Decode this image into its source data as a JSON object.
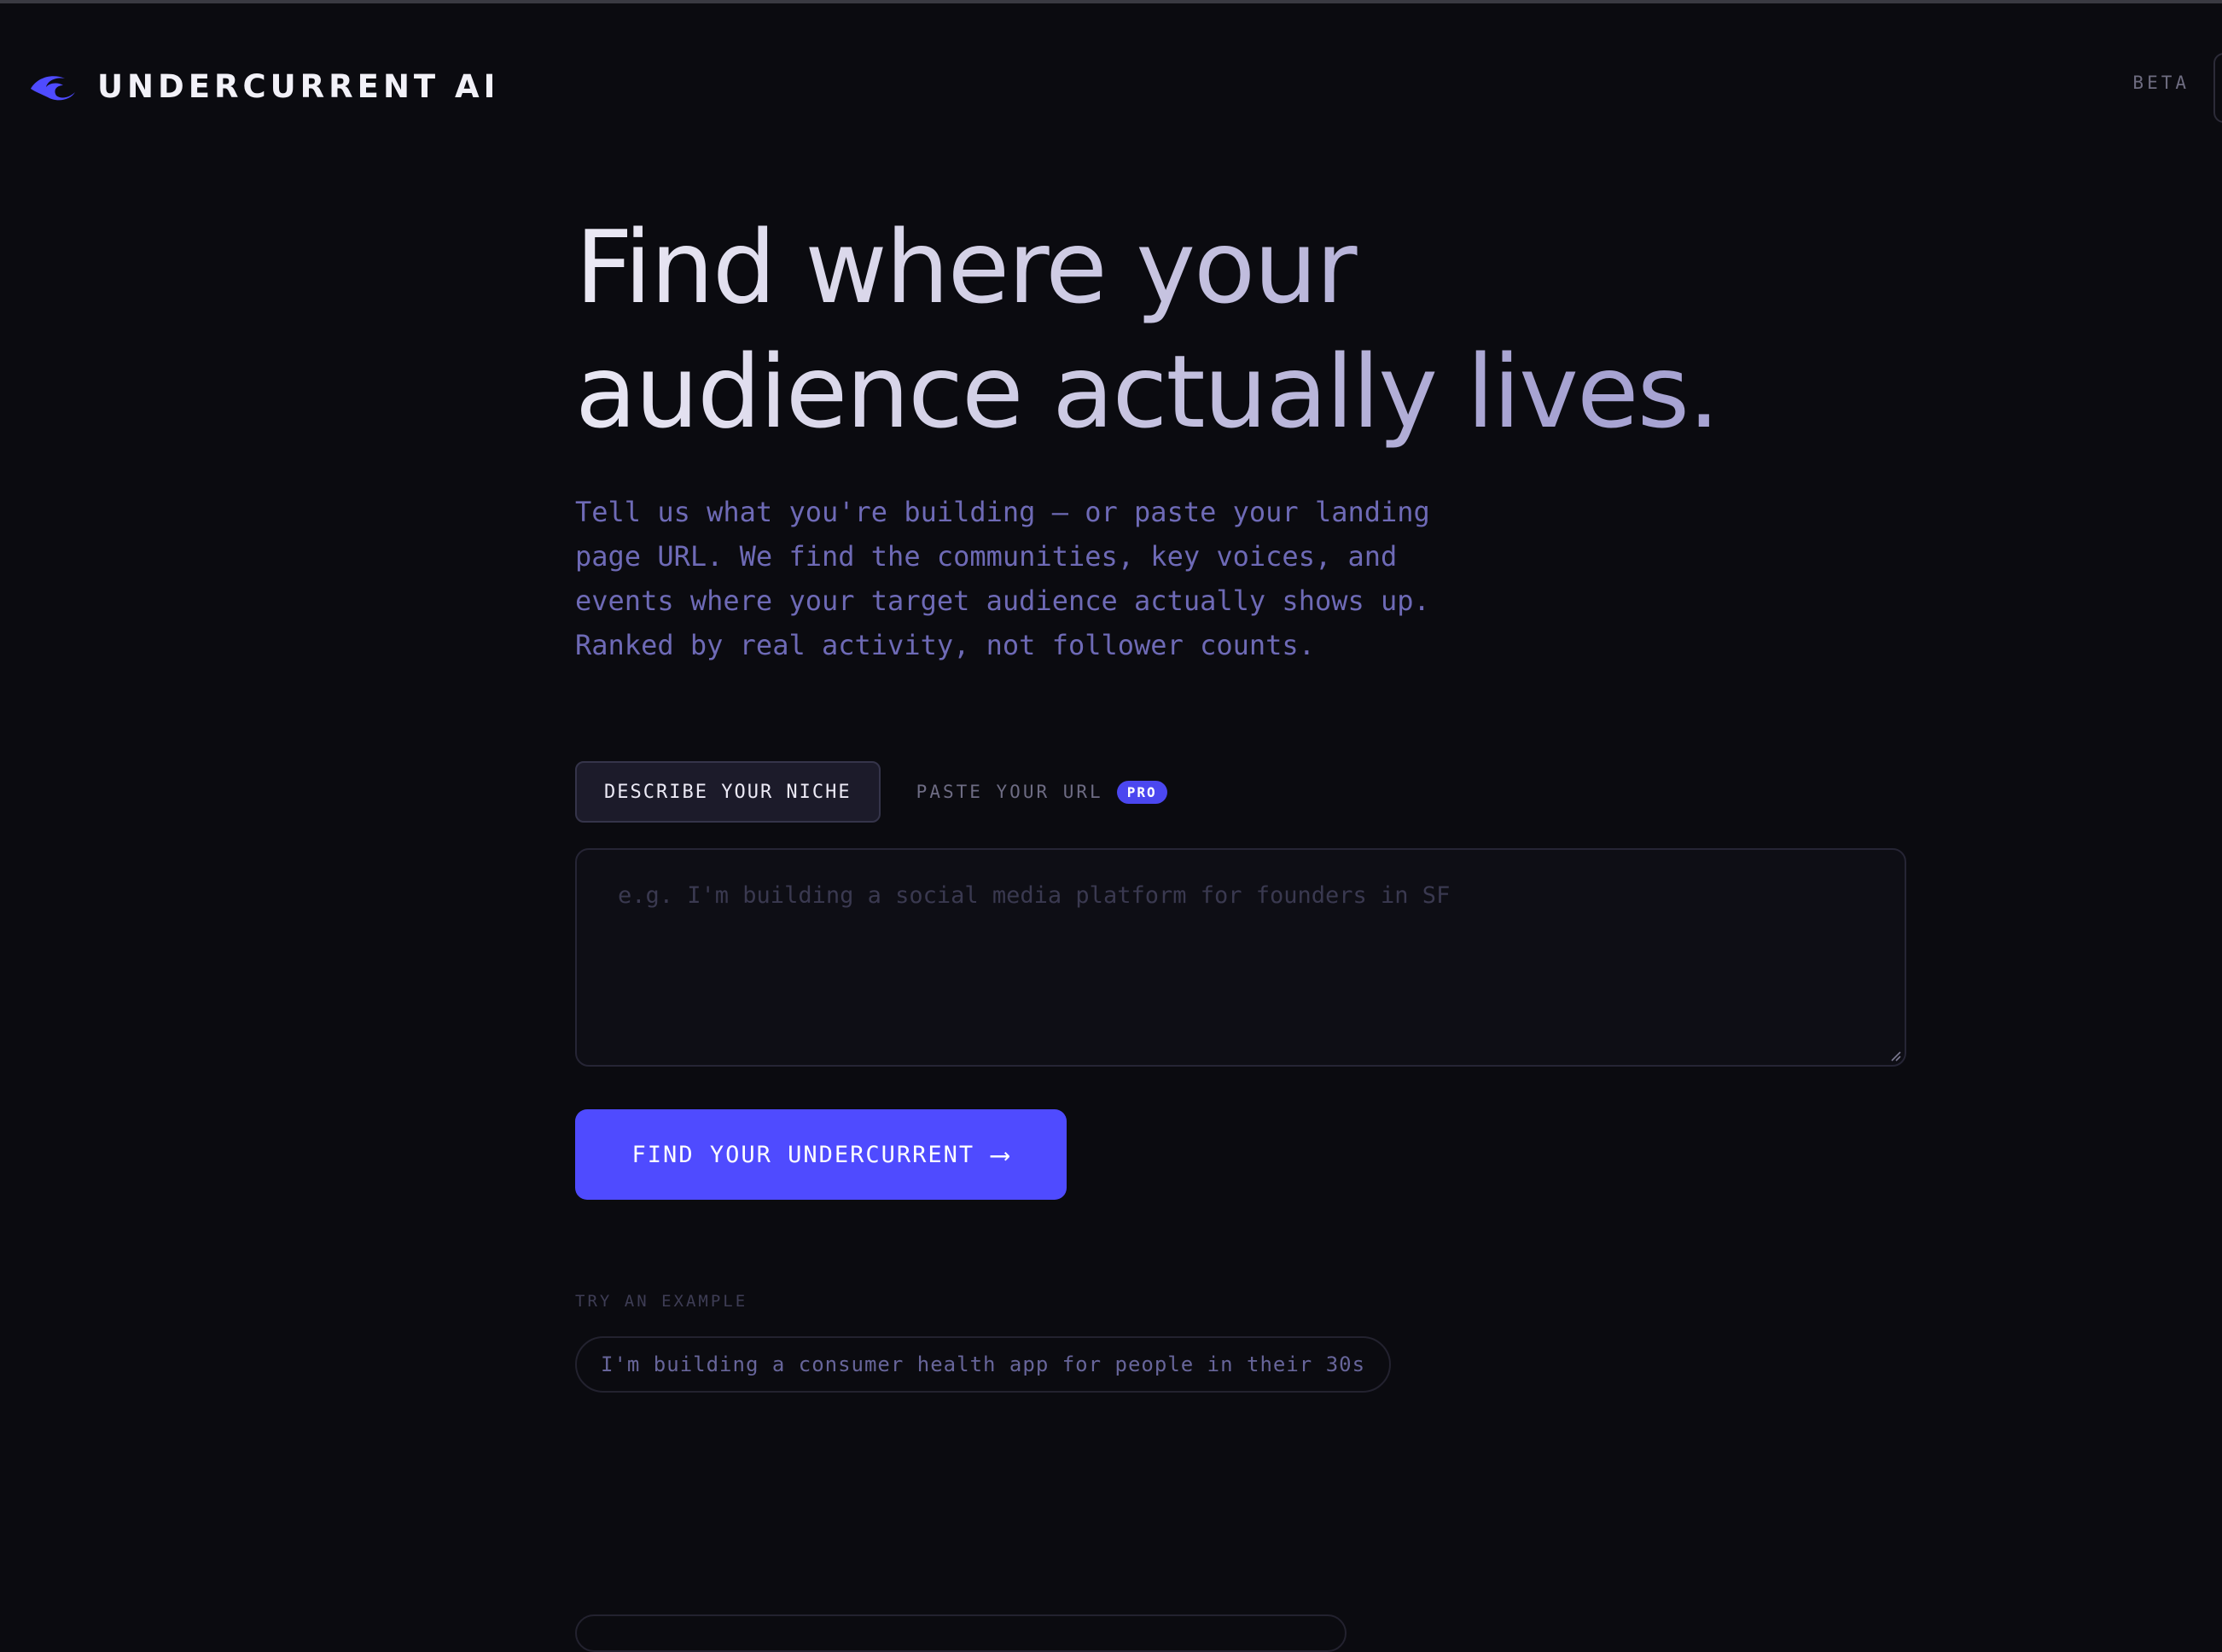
{
  "app": {
    "brand_name": "UNDERCURRENT AI",
    "brand_icon": "wave-icon",
    "badge": "BETA",
    "accent": "#4f4bff"
  },
  "hero": {
    "headline": "Find where your audience actually lives.",
    "subtitle": "Tell us what you're building — or paste your landing page URL. We find the communities, key voices, and events where your target audience actually shows up. Ranked by real activity, not follower counts."
  },
  "tabs": [
    {
      "label": "DESCRIBE YOUR NICHE",
      "active": true
    },
    {
      "label": "PASTE YOUR URL",
      "badge": "PRO",
      "active": false
    }
  ],
  "input": {
    "placeholder": "e.g. I'm building a social media platform for founders in SF",
    "value": ""
  },
  "cta": {
    "label": "FIND YOUR UNDERCURRENT",
    "arrow": "⟶"
  },
  "examples": {
    "label": "TRY AN EXAMPLE",
    "items": [
      "I'm building a consumer health app for people in their 30s"
    ]
  }
}
